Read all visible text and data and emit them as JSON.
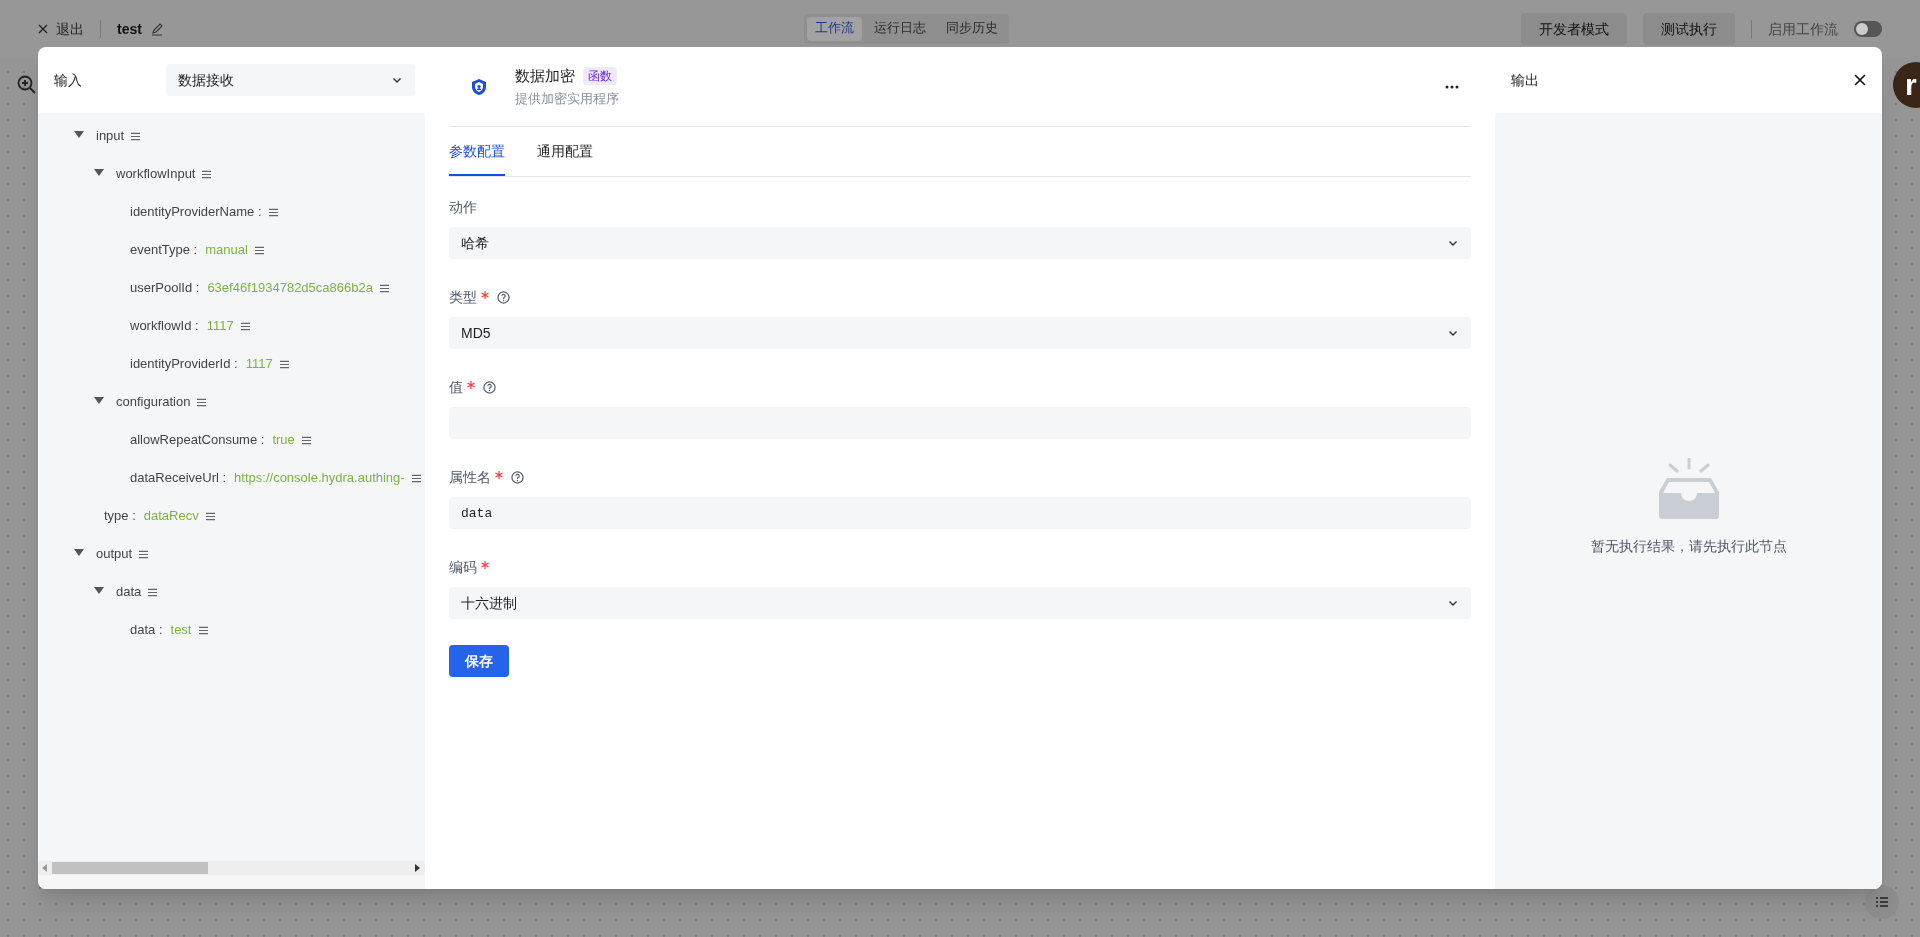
{
  "top_bar": {
    "exit": "退出",
    "title": "test",
    "view_tabs": [
      {
        "label": "工作流",
        "selected": true
      },
      {
        "label": "运行日志",
        "selected": false
      },
      {
        "label": "同步历史",
        "selected": false
      }
    ],
    "buttons": [
      "开发者模式",
      "测试执行"
    ],
    "toggle": {
      "label": "启用工作流",
      "on": false
    }
  },
  "avatar": {
    "letter": "r"
  },
  "input_panel": {
    "title": "输入",
    "source_select": "数据接收",
    "tree": [
      {
        "key": "input",
        "expanded": true,
        "children": [
          {
            "key": "workflowInput",
            "expanded": true,
            "children": [
              {
                "key": "identityProviderName :"
              },
              {
                "key": "eventType :",
                "value": "manual"
              },
              {
                "key": "userPoolId :",
                "value": "63ef46f1934782d5ca866b2a"
              },
              {
                "key": "workflowId :",
                "value": "1117"
              },
              {
                "key": "identityProviderId :",
                "value": "1117"
              }
            ]
          },
          {
            "key": "configuration",
            "expanded": true,
            "children": [
              {
                "key": "allowRepeatConsume :",
                "value": "true"
              },
              {
                "key": "dataReceiveUrl :",
                "value": "https://console.hydra.authing-"
              }
            ]
          },
          {
            "key": "type :",
            "value": "dataRecv"
          }
        ]
      },
      {
        "key": "output",
        "expanded": true,
        "children": [
          {
            "key": "data",
            "expanded": true,
            "children": [
              {
                "key": "data :",
                "value": "test"
              }
            ]
          }
        ]
      }
    ]
  },
  "node": {
    "title": "数据加密",
    "badge": "函数",
    "subtitle": "提供加密实用程序",
    "tabs": [
      {
        "label": "参数配置",
        "selected": true
      },
      {
        "label": "通用配置",
        "selected": false
      }
    ],
    "fields": [
      {
        "label": "动作",
        "required": false,
        "help": false,
        "kind": "select",
        "value": "哈希"
      },
      {
        "label": "类型",
        "required": true,
        "help": true,
        "kind": "select",
        "value": "MD5"
      },
      {
        "label": "值",
        "required": true,
        "help": true,
        "kind": "input"
      },
      {
        "label": "属性名",
        "required": true,
        "help": true,
        "kind": "input",
        "value": "data"
      },
      {
        "label": "编码",
        "required": true,
        "help": false,
        "kind": "select",
        "value": "十六进制"
      }
    ],
    "save_button": "保存"
  },
  "output_panel": {
    "title": "输出",
    "empty_text": "暂无执行结果，请先执行此节点"
  }
}
